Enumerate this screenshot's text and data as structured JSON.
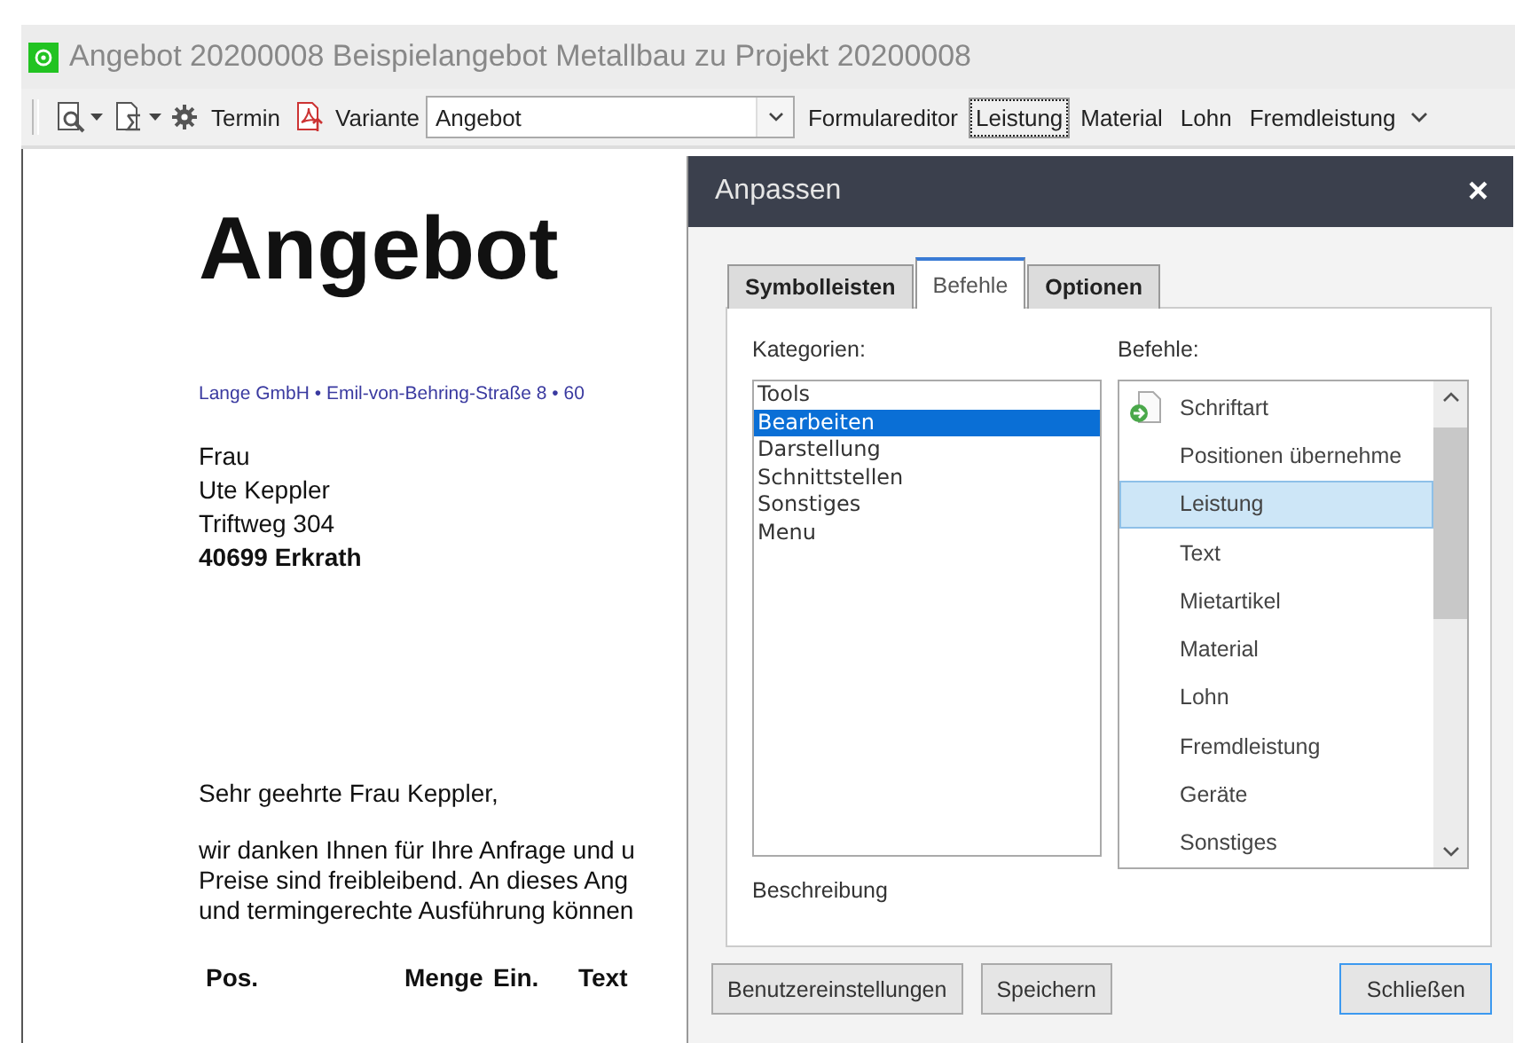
{
  "window": {
    "title": "Angebot 20200008 Beispielangebot Metallbau zu Projekt 20200008"
  },
  "toolbar": {
    "items": [
      {
        "kind": "icon",
        "dropdown": true
      },
      {
        "kind": "icon",
        "dropdown": true
      },
      {
        "kind": "icon",
        "dropdown": false
      },
      {
        "kind": "button",
        "label": "Termin",
        "selected": false
      },
      {
        "kind": "icon",
        "dropdown": false
      },
      {
        "kind": "label",
        "label": "Variante"
      },
      {
        "kind": "combo",
        "value": "Angebot"
      },
      {
        "kind": "button",
        "label": "Formulareditor",
        "selected": false
      },
      {
        "kind": "button",
        "label": "Leistung",
        "selected": true
      },
      {
        "kind": "button",
        "label": "Material",
        "selected": false
      },
      {
        "kind": "button",
        "label": "Lohn",
        "selected": false
      },
      {
        "kind": "button",
        "label": "Fremdleistung",
        "selected": false
      },
      {
        "kind": "overflow"
      }
    ]
  },
  "document": {
    "heading": "Angebot",
    "sender_line": "Lange GmbH • Emil-von-Behring-Straße 8 • 60",
    "address": [
      {
        "text": "Frau",
        "bold": false
      },
      {
        "text": "Ute Keppler",
        "bold": false
      },
      {
        "text": "Triftweg 304",
        "bold": false
      },
      {
        "text": "40699 Erkrath",
        "bold": true
      }
    ],
    "salutation": "Sehr geehrte Frau Keppler,",
    "paragraph": [
      "wir danken Ihnen für Ihre Anfrage und u",
      "Preise sind freibleibend. An dieses Ang",
      "und termingerechte Ausführung können"
    ],
    "table": {
      "columns": [
        "Pos.",
        "Menge",
        "Ein.",
        "Text"
      ]
    }
  },
  "dialog": {
    "title": "Anpassen",
    "close": "×",
    "tabs": [
      {
        "label": "Symbolleisten",
        "selected": false
      },
      {
        "label": "Befehle",
        "selected": true
      },
      {
        "label": "Optionen",
        "selected": false
      }
    ],
    "categories": {
      "label": "Kategorien:",
      "items": [
        {
          "label": "Tools",
          "selected": false
        },
        {
          "label": "Bearbeiten",
          "selected": true
        },
        {
          "label": "Darstellung",
          "selected": false
        },
        {
          "label": "Schnittstellen",
          "selected": false
        },
        {
          "label": "Sonstiges",
          "selected": false
        },
        {
          "label": "Menu",
          "selected": false
        }
      ]
    },
    "commands": {
      "label": "Befehle:",
      "items": [
        {
          "label": "Schriftart",
          "kind": "icon",
          "selected": false
        },
        {
          "label": "Positionen übernehme",
          "kind": "plain",
          "selected": false
        },
        {
          "label": "Leistung",
          "kind": "plain",
          "selected": true
        },
        {
          "label": "Text",
          "kind": "plain",
          "selected": false
        },
        {
          "label": "Mietartikel",
          "kind": "plain",
          "selected": false
        },
        {
          "label": "Material",
          "kind": "plain",
          "selected": false
        },
        {
          "label": "Lohn",
          "kind": "plain",
          "selected": false
        },
        {
          "label": "Fremdleistung",
          "kind": "plain",
          "selected": false
        },
        {
          "label": "Geräte",
          "kind": "plain",
          "selected": false
        },
        {
          "label": "Sonstiges",
          "kind": "plain",
          "selected": false
        }
      ]
    },
    "description_label": "Beschreibung",
    "buttons": [
      {
        "label": "Benutzereinstellungen",
        "default": false
      },
      {
        "label": "Speichern",
        "default": false
      },
      {
        "label": "Schließen",
        "default": true
      }
    ]
  }
}
